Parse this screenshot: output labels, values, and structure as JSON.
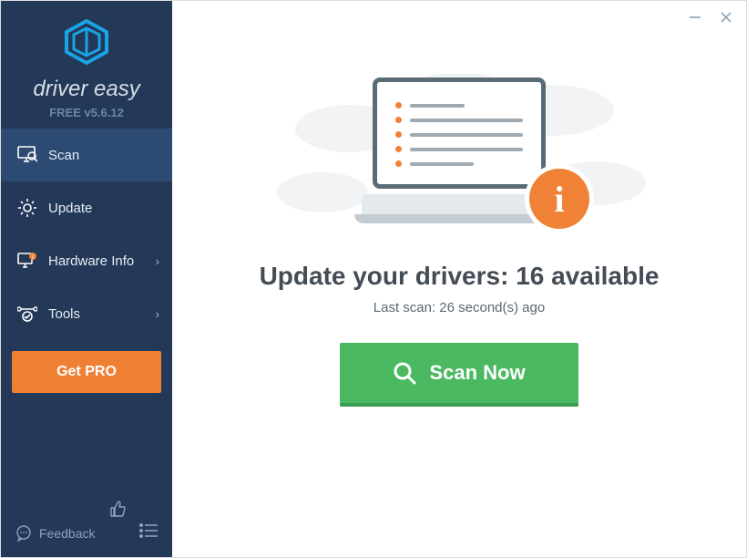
{
  "brand": {
    "name": "driver easy",
    "version_label": "FREE v5.6.12"
  },
  "nav": {
    "scan": "Scan",
    "update": "Update",
    "hardware": "Hardware Info",
    "tools": "Tools"
  },
  "get_pro_label": "Get PRO",
  "feedback_label": "Feedback",
  "main": {
    "heading": "Update your drivers: 16 available",
    "subhead": "Last scan: 26 second(s) ago",
    "scan_button": "Scan Now"
  },
  "colors": {
    "sidebar": "#243858",
    "accent": "#ef8033",
    "primary": "#4bb962",
    "logo": "#17a5e5"
  }
}
